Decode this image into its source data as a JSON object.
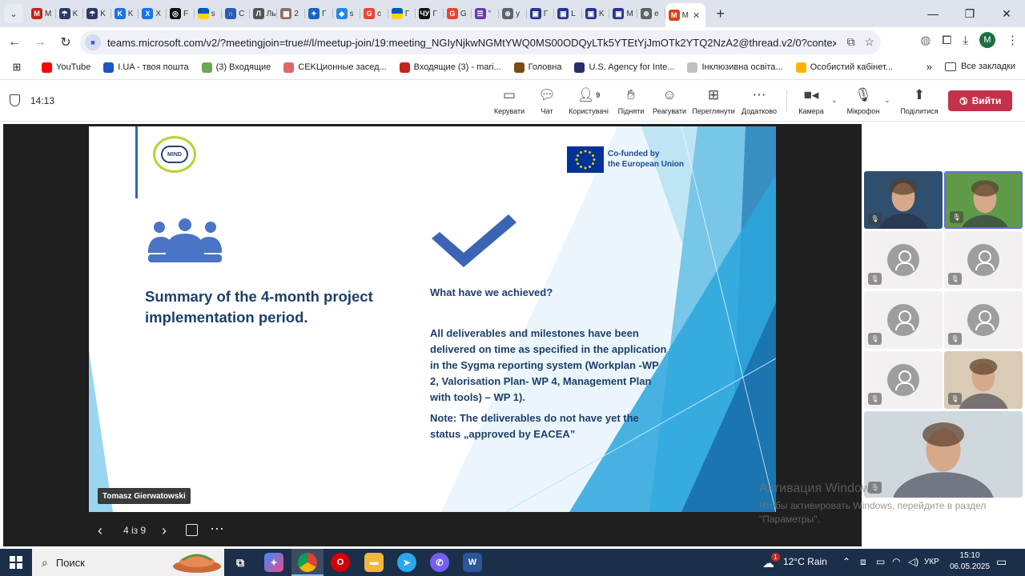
{
  "browser": {
    "tabs": [
      {
        "title": "M",
        "icon": "gmail-icon",
        "color": "#c5221f",
        "glyph": "M"
      },
      {
        "title": "K",
        "icon": "umbrella-icon",
        "color": "#2b3a67",
        "glyph": "☂"
      },
      {
        "title": "K",
        "icon": "umbrella-icon",
        "color": "#2b3a67",
        "glyph": "☂"
      },
      {
        "title": "K",
        "icon": "kaiser-icon",
        "color": "#1a73e8",
        "glyph": "K"
      },
      {
        "title": "X",
        "icon": "kaiser-icon",
        "color": "#1a73e8",
        "glyph": "X"
      },
      {
        "title": "F",
        "icon": "spiral-icon",
        "color": "#111111",
        "glyph": "◎"
      },
      {
        "title": "s",
        "icon": "ukraine-flag-icon",
        "color": "#ffd500",
        "glyph": ""
      },
      {
        "title": "C",
        "icon": "arch-icon",
        "color": "#2a5db0",
        "glyph": "∩"
      },
      {
        "title": "Ль",
        "icon": "lv-icon",
        "color": "#555555",
        "glyph": "Л"
      },
      {
        "title": "2",
        "icon": "image-icon",
        "color": "#8d6e63",
        "glyph": "▦"
      },
      {
        "title": "Г",
        "icon": "bird-icon",
        "color": "#1565c0",
        "glyph": "✦"
      },
      {
        "title": "s",
        "icon": "diamond-icon",
        "color": "#1e88e5",
        "glyph": "◆"
      },
      {
        "title": "c",
        "icon": "google-icon",
        "color": "#ea4335",
        "glyph": "G"
      },
      {
        "title": "Г",
        "icon": "ukraine-flag-icon",
        "color": "#0057b7",
        "glyph": ""
      },
      {
        "title": "Г",
        "icon": "ua-logo-icon",
        "color": "#111111",
        "glyph": "ЧУ"
      },
      {
        "title": "G",
        "icon": "google-icon",
        "color": "#ea4335",
        "glyph": "G"
      },
      {
        "title": "\"",
        "icon": "forms-icon",
        "color": "#673ab7",
        "glyph": "☰"
      },
      {
        "title": "y",
        "icon": "globe-icon",
        "color": "#5f6368",
        "glyph": "⊕"
      },
      {
        "title": "Г",
        "icon": "eu-icon",
        "color": "#283593",
        "glyph": "▣"
      },
      {
        "title": "L",
        "icon": "eu-icon",
        "color": "#283593",
        "glyph": "▣"
      },
      {
        "title": "K",
        "icon": "eu-icon",
        "color": "#283593",
        "glyph": "▣"
      },
      {
        "title": "M",
        "icon": "eu-icon",
        "color": "#283593",
        "glyph": "▣"
      },
      {
        "title": "e",
        "icon": "globe-icon",
        "color": "#5f6368",
        "glyph": "⊕"
      },
      {
        "title": "M",
        "icon": "teams-icon",
        "color": "#d84315",
        "glyph": "M"
      }
    ],
    "url": "teams.microsoft.com/v2/?meetingjoin=true#/l/meetup-join/19:meeting_NGIyNjkwNGMtYWQ0MS00ODQyLTk5YTEtYjJmOTk2YTQ2NzA2@thread.v2/0?context=%7b\"Tid\"%3a\"5...",
    "profile_initial": "M",
    "bookmarks": [
      {
        "label": "YouTube",
        "color": "#ff0000"
      },
      {
        "label": "I.UA - твоя пошта",
        "color": "#1a56c4"
      },
      {
        "label": "(3) Входящие",
        "color": "#6aa84f"
      },
      {
        "label": "CEKЦионные засед...",
        "color": "#e06666"
      },
      {
        "label": "Входящие (3) - mari...",
        "color": "#c5221f"
      },
      {
        "label": "Головна",
        "color": "#7a4b12"
      },
      {
        "label": "U.S. Agency for Inte...",
        "color": "#2b2b6f"
      },
      {
        "label": "Інклюзивна освіта...",
        "color": "#c0c0c0"
      },
      {
        "label": "Особистий кабінет...",
        "color": "#ffb300"
      }
    ],
    "bookmarks_all": "Все закладки"
  },
  "meeting": {
    "time": "14:13",
    "controls": {
      "manage": "Керувати",
      "chat": "Чат",
      "people": "Користувачі",
      "people_count": "9",
      "raise": "Підняти",
      "react": "Реагувати",
      "view": "Переглянути",
      "more": "Додатково",
      "camera": "Камера",
      "mic": "Мікрофон",
      "share": "Поділитися",
      "leave": "Вийти"
    }
  },
  "slide": {
    "logo_text": "MIND",
    "eu_line1": "Co-funded by",
    "eu_line2": "the European Union",
    "title": "Summary of the 4-month project implementation period.",
    "question": "What have we achieved?",
    "body": "All deliverables and milestones have been delivered on time as specified in the application in the Sygma reporting system (Workplan -WP 2, Valorisation Plan- WP 4, Management Plan with tools) – WP 1).",
    "note": "Note: The deliverables do not have yet the status „approved by EACEA”",
    "presenter": "Tomasz Gierwatowski",
    "counter": "4 із 9"
  },
  "participants": [
    {
      "type": "video",
      "bg": "#2f4f6f"
    },
    {
      "type": "video",
      "bg": "#5f9a4a",
      "selected": true
    },
    {
      "type": "avatar"
    },
    {
      "type": "avatar"
    },
    {
      "type": "avatar"
    },
    {
      "type": "avatar"
    },
    {
      "type": "avatar"
    },
    {
      "type": "video",
      "bg": "#d9cbb5"
    },
    {
      "type": "video-big",
      "bg": "#cfd8dc"
    }
  ],
  "watermark": {
    "title": "Активация Windows",
    "text": "Чтобы активировать Windows, перейдите в раздел \"Параметры\"."
  },
  "taskbar": {
    "search_placeholder": "Поиск",
    "weather": "12°C Rain",
    "weather_badge": "1",
    "lang": "УКР",
    "time": "15:10",
    "date": "06.05.2025"
  }
}
